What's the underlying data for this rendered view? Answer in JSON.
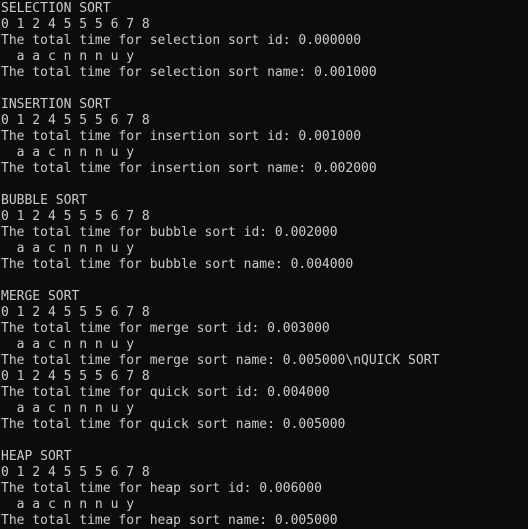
{
  "console": {
    "lines": [
      "SELECTION SORT",
      "0 1 2 4 5 5 5 6 7 8",
      "The total time for selection sort id: 0.000000",
      "  a a c n n n u y",
      "The total time for selection sort name: 0.001000",
      "",
      "INSERTION SORT",
      "0 1 2 4 5 5 5 6 7 8",
      "The total time for insertion sort id: 0.001000",
      "  a a c n n n u y",
      "The total time for insertion sort name: 0.002000",
      "",
      "BUBBLE SORT",
      "0 1 2 4 5 5 5 6 7 8",
      "The total time for bubble sort id: 0.002000",
      "  a a c n n n u y",
      "The total time for bubble sort name: 0.004000",
      "",
      "MERGE SORT",
      "0 1 2 4 5 5 5 6 7 8",
      "The total time for merge sort id: 0.003000",
      "  a a c n n n u y",
      "The total time for merge sort name: 0.005000\\nQUICK SORT",
      "0 1 2 4 5 5 5 6 7 8",
      "The total time for quick sort id: 0.004000",
      "  a a c n n n u y",
      "The total time for quick sort name: 0.005000",
      "",
      "HEAP SORT",
      "0 1 2 4 5 5 5 6 7 8",
      "The total time for heap sort id: 0.006000",
      "  a a c n n n u y",
      "The total time for heap sort name: 0.005000"
    ]
  },
  "colors": {
    "background": "#0c0c0c",
    "text": "#cccccc"
  }
}
